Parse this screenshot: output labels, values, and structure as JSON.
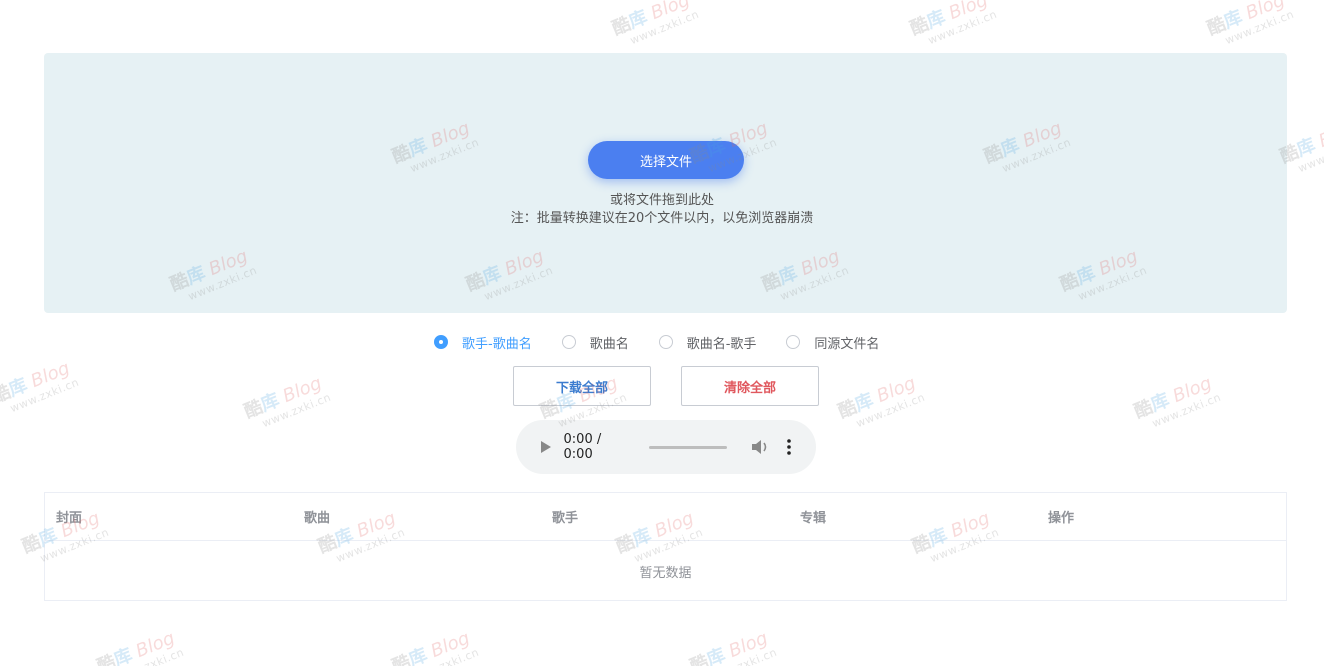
{
  "upload": {
    "select_label": "选择文件",
    "hint_line1": "或将文件拖到此处",
    "hint_line2": "注：批量转换建议在20个文件以内，以免浏览器崩溃"
  },
  "naming": {
    "options": [
      {
        "label": "歌手-歌曲名",
        "checked": true
      },
      {
        "label": "歌曲名",
        "checked": false
      },
      {
        "label": "歌曲名-歌手",
        "checked": false
      },
      {
        "label": "同源文件名",
        "checked": false
      }
    ]
  },
  "actions": {
    "download_all": "下载全部",
    "clear_all": "清除全部"
  },
  "player": {
    "time": "0:00 / 0:00"
  },
  "table": {
    "columns": [
      "封面",
      "歌曲",
      "歌手",
      "专辑",
      "操作"
    ],
    "empty_text": "暂无数据"
  },
  "watermark": {
    "brand_chars": [
      "酷",
      "库",
      "Blog"
    ],
    "url": "www.zxki.cn"
  },
  "colors": {
    "primary": "#4b7ff0",
    "radio_active": "#409eff",
    "danger": "#e0585e",
    "dropzone_bg": "#e6f1f4"
  }
}
